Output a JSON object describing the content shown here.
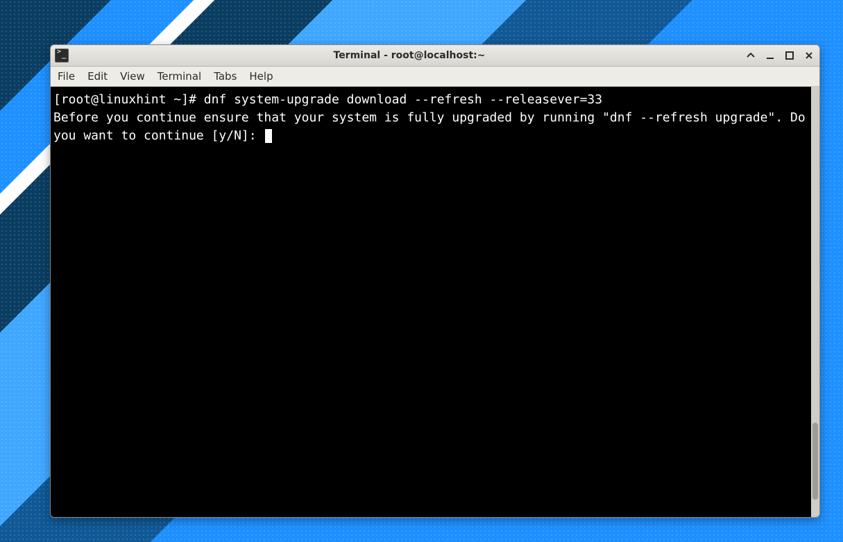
{
  "window": {
    "title": "Terminal - root@localhost:~"
  },
  "menubar": {
    "items": [
      "File",
      "Edit",
      "View",
      "Terminal",
      "Tabs",
      "Help"
    ]
  },
  "terminal": {
    "prompt": "[root@linuxhint ~]# ",
    "command": "dnf system-upgrade download --refresh --releasever=33",
    "output": "Before you continue ensure that your system is fully upgraded by running \"dnf --refresh upgrade\". Do you want to continue [y/N]: "
  }
}
